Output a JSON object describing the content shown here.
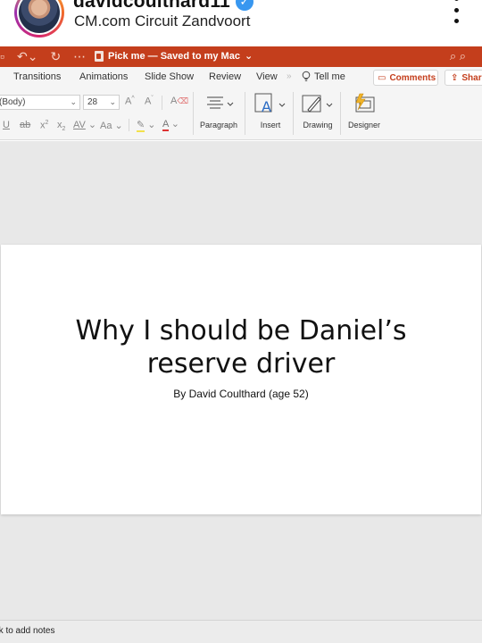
{
  "post": {
    "username": "davidcoulthard11",
    "location": "CM.com Circuit Zandvoort",
    "verified_mark": "✓",
    "more_icon": "more-vertical-icon"
  },
  "app": {
    "accent_color": "#c43e1c",
    "document_title": "Pick me — Saved to my Mac",
    "title_caret": "⌄"
  },
  "ribbon_tabs": [
    "Transitions",
    "Animations",
    "Slide Show",
    "Review",
    "View"
  ],
  "tell_me": "Tell me",
  "comments_label": "Comments",
  "share_label": "Share",
  "toolbar": {
    "font_name": "(Body)",
    "font_size": "28",
    "paragraph_label": "Paragraph",
    "insert_label": "Insert",
    "drawing_label": "Drawing",
    "designer_label": "Designer"
  },
  "slide": {
    "title_line1": "Why I should be Daniel’s",
    "title_line2": "reserve driver",
    "subtitle": "By David Coulthard (age 52)"
  },
  "notes_placeholder": "Click to add notes"
}
